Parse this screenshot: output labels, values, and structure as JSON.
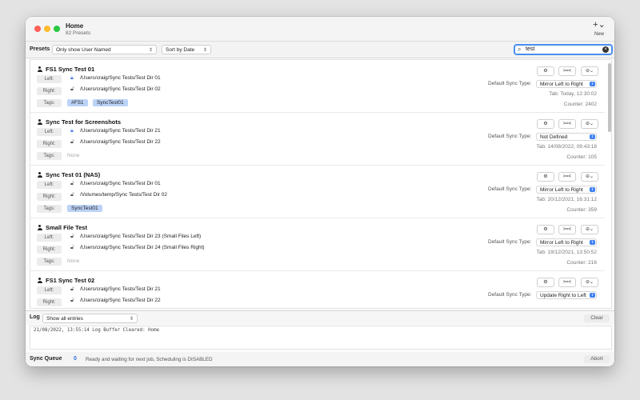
{
  "window": {
    "title": "Home",
    "subtitle": "82 Presets",
    "new_label": "New"
  },
  "toolbar": {
    "presets_label": "Presets",
    "filter_selected": "Only show User Named",
    "sort_selected": "Sort by Date",
    "search_value": "test"
  },
  "labels": {
    "left": "Left:",
    "right": "Right:",
    "tags": "Tags:",
    "none": "None",
    "default_sync_type": "Default Sync Type:"
  },
  "presets": [
    {
      "name": "FS1 Sync Test 01",
      "left_path": "/Users/craig/Sync Tests/Test Dir 01",
      "left_locked": true,
      "right_path": "/Users/craig/Sync Tests/Test Dir 02",
      "right_locked": false,
      "tags": [
        "#FS1",
        "SyncTest01"
      ],
      "sync_type": "Mirror Left to Right",
      "tab": "Tab: Today, 12:30:02",
      "counter": "Counter: 2402"
    },
    {
      "name": "Sync Test for Screenshots",
      "left_path": "/Users/craig/Sync Tests/Test Dir 21",
      "left_locked": true,
      "right_path": "/Users/craig/Sync Tests/Test Dir 22",
      "right_locked": false,
      "tags": [],
      "sync_type": "Not Defined",
      "tab": "Tab: 14/08/2022, 09:43:18",
      "counter": "Counter: 105"
    },
    {
      "name": "Sync Test 01 (NAS)",
      "left_path": "/Users/craig/Sync Tests/Test Dir 01",
      "left_locked": false,
      "right_path": "/Volumes/temp/Sync Tests/Test Dir 02",
      "right_locked": false,
      "tags": [
        "SyncTest01"
      ],
      "sync_type": "Mirror Left to Right",
      "tab": "Tab: 20/12/2021, 16:31:12",
      "counter": "Counter: 359"
    },
    {
      "name": "Small File Test",
      "left_path": "/Users/craig/Sync Tests/Test Dir 23 (Small Files Left)",
      "left_locked": false,
      "right_path": "/Users/craig/Sync Tests/Test Dir 24 (Small Files Right)",
      "right_locked": false,
      "tags": [],
      "sync_type": "Mirror Left to Right",
      "tab": "Tab: 19/12/2021, 13:50:52",
      "counter": "Counter: 216"
    },
    {
      "name": "FS1 Sync Test 02",
      "left_path": "/Users/craig/Sync Tests/Test Dir 21",
      "left_locked": false,
      "right_path": "/Users/craig/Sync Tests/Test Dir 22",
      "right_locked": false,
      "tags": [],
      "sync_type": "Update Right to Left",
      "tab": "",
      "counter": ""
    }
  ],
  "log": {
    "label": "Log",
    "filter_selected": "Show all entries",
    "clear_label": "Clear",
    "lines": [
      "21/08/2022, 13:55:14  Log Buffer Cleared: Home"
    ]
  },
  "queue": {
    "label": "Sync Queue",
    "count": "0",
    "status": "Ready and waiting for next job,  Scheduling is DISABLED",
    "abort_label": "Abort"
  },
  "icons": {
    "gear": "⚙",
    "compare": ">=<",
    "more": "⊖⌄",
    "lock": "🔒",
    "unlock": "🔓"
  },
  "colors": {
    "accent": "#3b7ef3",
    "tag_chip": "#bcd3f7"
  }
}
